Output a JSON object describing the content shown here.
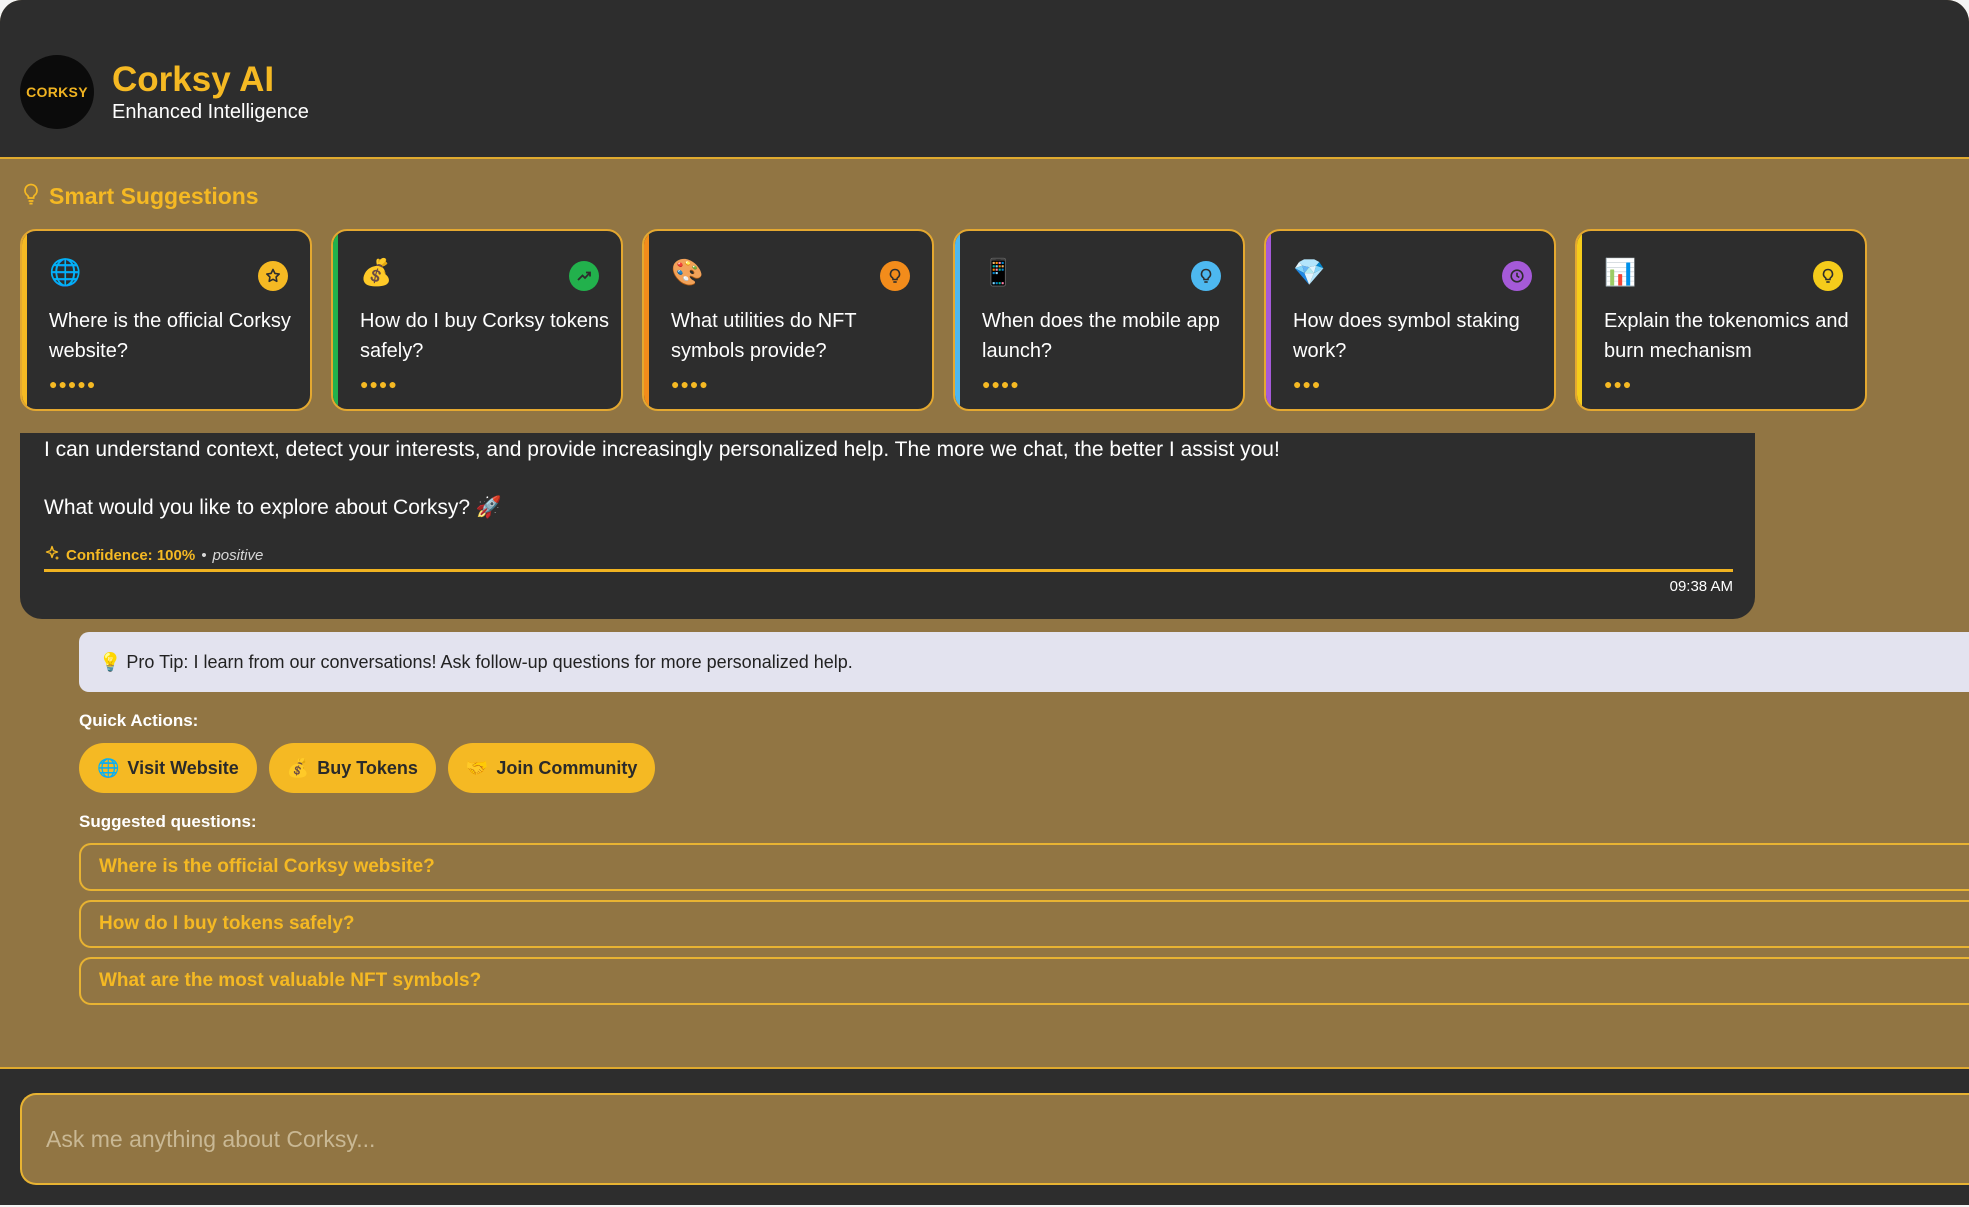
{
  "header": {
    "logo_text": "CORKSY",
    "title": "Corksy AI",
    "subtitle": "Enhanced Intelligence"
  },
  "smart_suggestions": {
    "title": "Smart Suggestions",
    "icon": "lightbulb-icon",
    "cards": [
      {
        "emoji": "🌐",
        "text": "Where is the official Corksy website?",
        "badge": "star-icon",
        "badge_color": "#f5b923",
        "bar_color": "#f5b923",
        "dots": "●●●●●"
      },
      {
        "emoji": "💰",
        "text": "How do I buy Corksy tokens safely?",
        "badge": "trending-up-icon",
        "badge_color": "#22b14c",
        "bar_color": "#22b14c",
        "dots": "●●●●"
      },
      {
        "emoji": "🎨",
        "text": "What utilities do NFT symbols provide?",
        "badge": "lightbulb-icon",
        "badge_color": "#f28c1b",
        "bar_color": "#f28c1b",
        "dots": "●●●●"
      },
      {
        "emoji": "📱",
        "text": "When does the mobile app launch?",
        "badge": "lightbulb-icon",
        "badge_color": "#4db8f0",
        "bar_color": "#4db8f0",
        "dots": "●●●●"
      },
      {
        "emoji": "💎",
        "text": "How does symbol staking work?",
        "badge": "clock-icon",
        "badge_color": "#a55ad8",
        "bar_color": "#a55ad8",
        "dots": "●●●"
      },
      {
        "emoji": "📊",
        "text": "Explain the tokenomics and burn mechanism",
        "badge": "lightbulb-icon",
        "badge_color": "#f5cc1b",
        "bar_color": "#f5cc1b",
        "dots": "●●●"
      }
    ]
  },
  "message": {
    "line1": "I can understand context, detect your interests, and provide increasingly personalized help. The more we chat, the better I assist you!",
    "line2": "What would you like to explore about Corksy? 🚀",
    "confidence": "Confidence: 100%",
    "sentiment_sep": "•",
    "sentiment": "positive",
    "time": "09:38 AM"
  },
  "pro_tip": "💡 Pro Tip: I learn from our conversations! Ask follow-up questions for more personalized help.",
  "quick_actions": {
    "label": "Quick Actions:",
    "buttons": [
      {
        "emoji": "🌐",
        "label": "Visit Website"
      },
      {
        "emoji": "💰",
        "label": "Buy Tokens"
      },
      {
        "emoji": "🤝",
        "label": "Join Community"
      }
    ]
  },
  "suggested_questions": {
    "label": "Suggested questions:",
    "items": [
      "Where is the official Corksy website?",
      "How do I buy tokens safely?",
      "What are the most valuable NFT symbols?"
    ]
  },
  "input": {
    "placeholder": "Ask me anything about Corksy..."
  },
  "colors": {
    "accent": "#f5b923",
    "panel": "#2d2d2d",
    "background": "#917543"
  }
}
